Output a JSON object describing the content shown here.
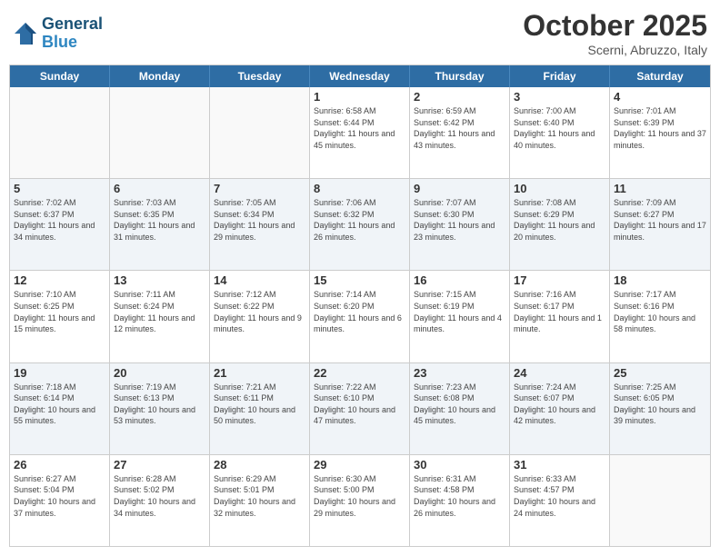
{
  "header": {
    "logo_line1": "General",
    "logo_line2": "Blue",
    "month": "October 2025",
    "location": "Scerni, Abruzzo, Italy"
  },
  "weekdays": [
    "Sunday",
    "Monday",
    "Tuesday",
    "Wednesday",
    "Thursday",
    "Friday",
    "Saturday"
  ],
  "rows": [
    {
      "shaded": false,
      "cells": [
        {
          "empty": true,
          "day": ""
        },
        {
          "empty": true,
          "day": ""
        },
        {
          "empty": true,
          "day": ""
        },
        {
          "empty": false,
          "day": "1",
          "sunrise": "6:58 AM",
          "sunset": "6:44 PM",
          "daylight": "11 hours and 45 minutes."
        },
        {
          "empty": false,
          "day": "2",
          "sunrise": "6:59 AM",
          "sunset": "6:42 PM",
          "daylight": "11 hours and 43 minutes."
        },
        {
          "empty": false,
          "day": "3",
          "sunrise": "7:00 AM",
          "sunset": "6:40 PM",
          "daylight": "11 hours and 40 minutes."
        },
        {
          "empty": false,
          "day": "4",
          "sunrise": "7:01 AM",
          "sunset": "6:39 PM",
          "daylight": "11 hours and 37 minutes."
        }
      ]
    },
    {
      "shaded": true,
      "cells": [
        {
          "empty": false,
          "day": "5",
          "sunrise": "7:02 AM",
          "sunset": "6:37 PM",
          "daylight": "11 hours and 34 minutes."
        },
        {
          "empty": false,
          "day": "6",
          "sunrise": "7:03 AM",
          "sunset": "6:35 PM",
          "daylight": "11 hours and 31 minutes."
        },
        {
          "empty": false,
          "day": "7",
          "sunrise": "7:05 AM",
          "sunset": "6:34 PM",
          "daylight": "11 hours and 29 minutes."
        },
        {
          "empty": false,
          "day": "8",
          "sunrise": "7:06 AM",
          "sunset": "6:32 PM",
          "daylight": "11 hours and 26 minutes."
        },
        {
          "empty": false,
          "day": "9",
          "sunrise": "7:07 AM",
          "sunset": "6:30 PM",
          "daylight": "11 hours and 23 minutes."
        },
        {
          "empty": false,
          "day": "10",
          "sunrise": "7:08 AM",
          "sunset": "6:29 PM",
          "daylight": "11 hours and 20 minutes."
        },
        {
          "empty": false,
          "day": "11",
          "sunrise": "7:09 AM",
          "sunset": "6:27 PM",
          "daylight": "11 hours and 17 minutes."
        }
      ]
    },
    {
      "shaded": false,
      "cells": [
        {
          "empty": false,
          "day": "12",
          "sunrise": "7:10 AM",
          "sunset": "6:25 PM",
          "daylight": "11 hours and 15 minutes."
        },
        {
          "empty": false,
          "day": "13",
          "sunrise": "7:11 AM",
          "sunset": "6:24 PM",
          "daylight": "11 hours and 12 minutes."
        },
        {
          "empty": false,
          "day": "14",
          "sunrise": "7:12 AM",
          "sunset": "6:22 PM",
          "daylight": "11 hours and 9 minutes."
        },
        {
          "empty": false,
          "day": "15",
          "sunrise": "7:14 AM",
          "sunset": "6:20 PM",
          "daylight": "11 hours and 6 minutes."
        },
        {
          "empty": false,
          "day": "16",
          "sunrise": "7:15 AM",
          "sunset": "6:19 PM",
          "daylight": "11 hours and 4 minutes."
        },
        {
          "empty": false,
          "day": "17",
          "sunrise": "7:16 AM",
          "sunset": "6:17 PM",
          "daylight": "11 hours and 1 minute."
        },
        {
          "empty": false,
          "day": "18",
          "sunrise": "7:17 AM",
          "sunset": "6:16 PM",
          "daylight": "10 hours and 58 minutes."
        }
      ]
    },
    {
      "shaded": true,
      "cells": [
        {
          "empty": false,
          "day": "19",
          "sunrise": "7:18 AM",
          "sunset": "6:14 PM",
          "daylight": "10 hours and 55 minutes."
        },
        {
          "empty": false,
          "day": "20",
          "sunrise": "7:19 AM",
          "sunset": "6:13 PM",
          "daylight": "10 hours and 53 minutes."
        },
        {
          "empty": false,
          "day": "21",
          "sunrise": "7:21 AM",
          "sunset": "6:11 PM",
          "daylight": "10 hours and 50 minutes."
        },
        {
          "empty": false,
          "day": "22",
          "sunrise": "7:22 AM",
          "sunset": "6:10 PM",
          "daylight": "10 hours and 47 minutes."
        },
        {
          "empty": false,
          "day": "23",
          "sunrise": "7:23 AM",
          "sunset": "6:08 PM",
          "daylight": "10 hours and 45 minutes."
        },
        {
          "empty": false,
          "day": "24",
          "sunrise": "7:24 AM",
          "sunset": "6:07 PM",
          "daylight": "10 hours and 42 minutes."
        },
        {
          "empty": false,
          "day": "25",
          "sunrise": "7:25 AM",
          "sunset": "6:05 PM",
          "daylight": "10 hours and 39 minutes."
        }
      ]
    },
    {
      "shaded": false,
      "cells": [
        {
          "empty": false,
          "day": "26",
          "sunrise": "6:27 AM",
          "sunset": "5:04 PM",
          "daylight": "10 hours and 37 minutes."
        },
        {
          "empty": false,
          "day": "27",
          "sunrise": "6:28 AM",
          "sunset": "5:02 PM",
          "daylight": "10 hours and 34 minutes."
        },
        {
          "empty": false,
          "day": "28",
          "sunrise": "6:29 AM",
          "sunset": "5:01 PM",
          "daylight": "10 hours and 32 minutes."
        },
        {
          "empty": false,
          "day": "29",
          "sunrise": "6:30 AM",
          "sunset": "5:00 PM",
          "daylight": "10 hours and 29 minutes."
        },
        {
          "empty": false,
          "day": "30",
          "sunrise": "6:31 AM",
          "sunset": "4:58 PM",
          "daylight": "10 hours and 26 minutes."
        },
        {
          "empty": false,
          "day": "31",
          "sunrise": "6:33 AM",
          "sunset": "4:57 PM",
          "daylight": "10 hours and 24 minutes."
        },
        {
          "empty": true,
          "day": ""
        }
      ]
    }
  ]
}
